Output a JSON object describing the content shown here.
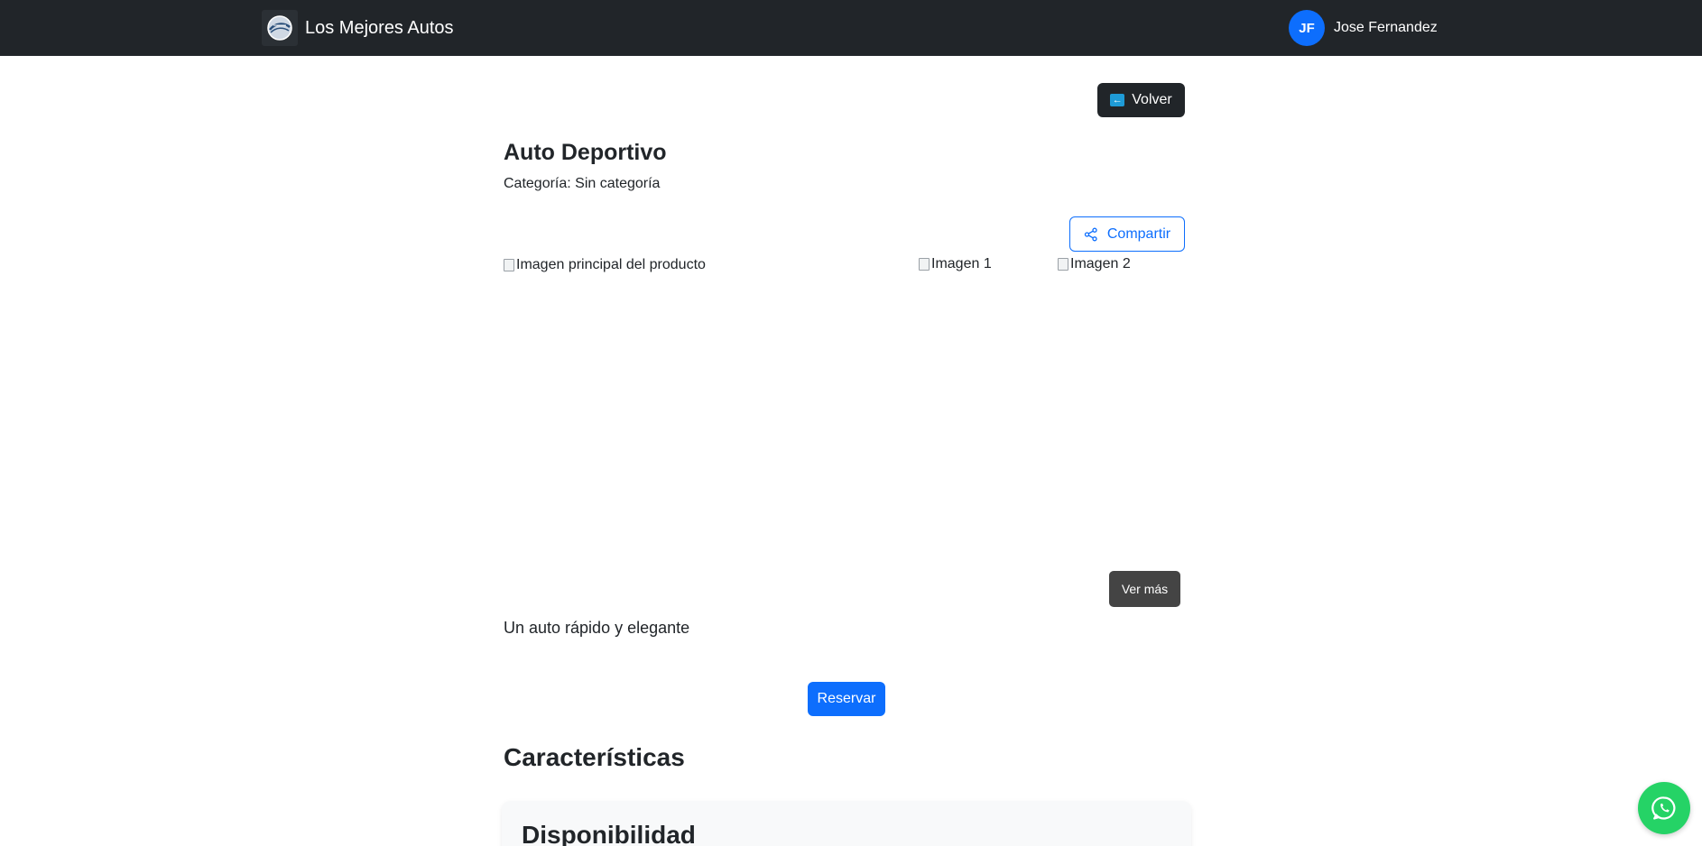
{
  "navbar": {
    "brand": "Los Mejores Autos",
    "user": {
      "initials": "JF",
      "name": "Jose Fernandez"
    }
  },
  "actions": {
    "back_label": "Volver"
  },
  "product": {
    "title": "Auto Deportivo",
    "category": "Categoría: Sin categoría",
    "share_label": "Compartir",
    "main_image_alt": "Imagen principal del producto",
    "thumbnails": [
      "Imagen 1",
      "Imagen 2"
    ],
    "see_more_label": "Ver más",
    "description": "Un auto rápido y elegante",
    "reserve_label": "Reservar"
  },
  "features": {
    "heading": "Características",
    "card_title": "Disponibilidad"
  },
  "icons": {
    "logo": "brand-logo-icon",
    "back": "arrow-left-icon",
    "share": "share-icon",
    "whatsapp": "whatsapp-icon"
  },
  "colors": {
    "navbar": "#212529",
    "primary": "#0d6efd",
    "whatsapp": "#25d366"
  }
}
